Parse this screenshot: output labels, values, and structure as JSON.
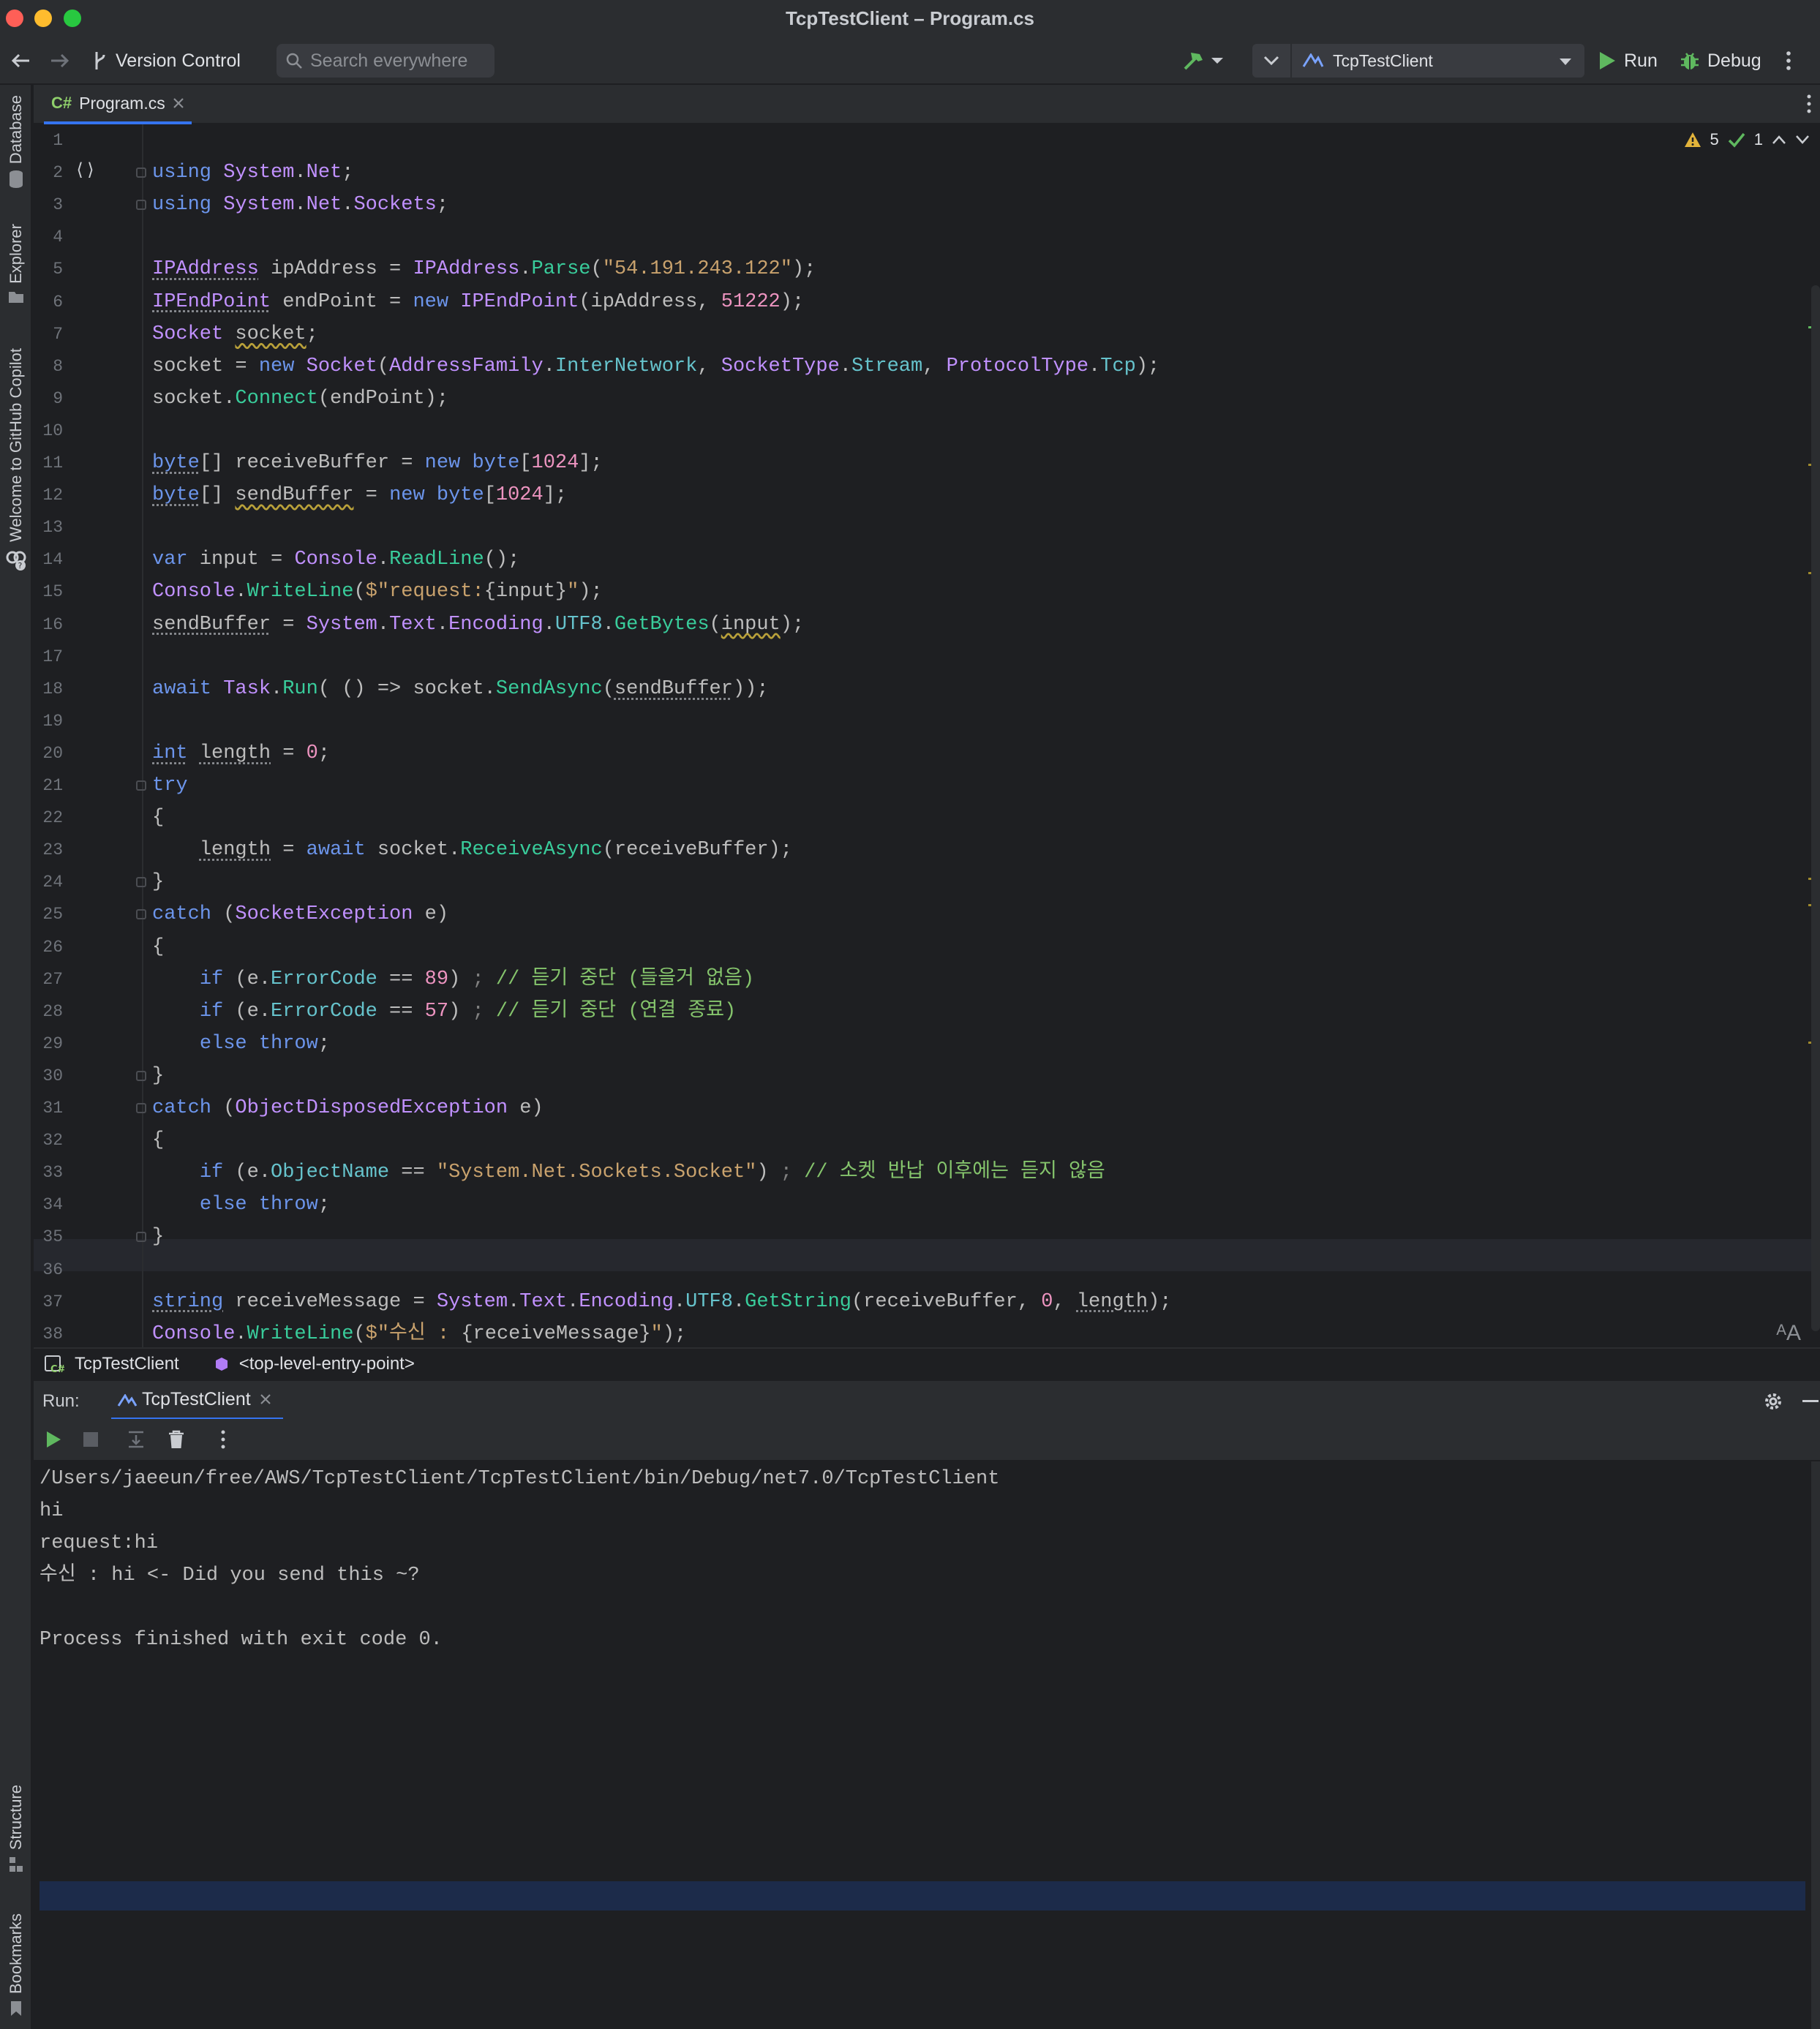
{
  "window": {
    "title": "TcpTestClient – Program.cs"
  },
  "toolbar": {
    "vcs_label": "Version Control",
    "search_placeholder": "Search everywhere",
    "config_name": "TcpTestClient",
    "run_label": "Run",
    "debug_label": "Debug"
  },
  "left_tools": {
    "database": "Database",
    "explorer": "Explorer",
    "copilot": "Welcome to GitHub Copilot",
    "structure": "Structure",
    "bookmarks": "Bookmarks"
  },
  "editor": {
    "tab_lang": "C#",
    "tab_name": "Program.cs",
    "warnings": "5",
    "ok": "1",
    "lines": [
      [],
      [
        [
          "k",
          "using "
        ],
        [
          "t",
          "System"
        ],
        [
          "p",
          "."
        ],
        [
          "t",
          "Net"
        ],
        [
          "p",
          ";"
        ]
      ],
      [
        [
          "k",
          "using "
        ],
        [
          "t",
          "System"
        ],
        [
          "p",
          "."
        ],
        [
          "t",
          "Net"
        ],
        [
          "p",
          "."
        ],
        [
          "t",
          "Sockets"
        ],
        [
          "p",
          ";"
        ]
      ],
      [],
      [
        [
          "tu",
          "IPAddress"
        ],
        [
          "p",
          " ipAddress = "
        ],
        [
          "t",
          "IPAddress"
        ],
        [
          "p",
          "."
        ],
        [
          "m",
          "Parse"
        ],
        [
          "p",
          "("
        ],
        [
          "s",
          "\"54.191.243.122\""
        ],
        [
          "p",
          ");"
        ]
      ],
      [
        [
          "tu",
          "IPEndPoint"
        ],
        [
          "p",
          " endPoint = "
        ],
        [
          "k",
          "new "
        ],
        [
          "t",
          "IPEndPoint"
        ],
        [
          "p",
          "(ipAddress, "
        ],
        [
          "n",
          "51222"
        ],
        [
          "p",
          ");"
        ]
      ],
      [
        [
          "t",
          "Socket"
        ],
        [
          "p",
          " "
        ],
        [
          "pw",
          "socket"
        ],
        [
          "p",
          ";"
        ]
      ],
      [
        [
          "p",
          "socket = "
        ],
        [
          "k",
          "new "
        ],
        [
          "t",
          "Socket"
        ],
        [
          "p",
          "("
        ],
        [
          "t",
          "AddressFamily"
        ],
        [
          "p",
          "."
        ],
        [
          "g",
          "InterNetwork"
        ],
        [
          "p",
          ", "
        ],
        [
          "t",
          "SocketType"
        ],
        [
          "p",
          "."
        ],
        [
          "g",
          "Stream"
        ],
        [
          "p",
          ", "
        ],
        [
          "t",
          "ProtocolType"
        ],
        [
          "p",
          "."
        ],
        [
          "g",
          "Tcp"
        ],
        [
          "p",
          ");"
        ]
      ],
      [
        [
          "p",
          "socket."
        ],
        [
          "m",
          "Connect"
        ],
        [
          "p",
          "(endPoint);"
        ]
      ],
      [],
      [
        [
          "ku",
          "byte"
        ],
        [
          "p",
          "[] receiveBuffer = "
        ],
        [
          "k",
          "new "
        ],
        [
          "k",
          "byte"
        ],
        [
          "p",
          "["
        ],
        [
          "n",
          "1024"
        ],
        [
          "p",
          "];"
        ]
      ],
      [
        [
          "ku",
          "byte"
        ],
        [
          "p",
          "[] "
        ],
        [
          "pw",
          "sendBuffer"
        ],
        [
          "p",
          " = "
        ],
        [
          "k",
          "new "
        ],
        [
          "k",
          "byte"
        ],
        [
          "p",
          "["
        ],
        [
          "n",
          "1024"
        ],
        [
          "p",
          "];"
        ]
      ],
      [],
      [
        [
          "k",
          "var"
        ],
        [
          "p",
          " input = "
        ],
        [
          "t",
          "Console"
        ],
        [
          "p",
          "."
        ],
        [
          "m",
          "ReadLine"
        ],
        [
          "p",
          "();"
        ]
      ],
      [
        [
          "t",
          "Console"
        ],
        [
          "p",
          "."
        ],
        [
          "m",
          "WriteLine"
        ],
        [
          "p",
          "("
        ],
        [
          "s",
          "$\"request:"
        ],
        [
          "p",
          "{input}"
        ],
        [
          "s",
          "\""
        ],
        [
          "p",
          ");"
        ]
      ],
      [
        [
          "pu",
          "sendBuffer"
        ],
        [
          "p",
          " = "
        ],
        [
          "t",
          "System"
        ],
        [
          "p",
          "."
        ],
        [
          "t",
          "Text"
        ],
        [
          "p",
          "."
        ],
        [
          "t",
          "Encoding"
        ],
        [
          "p",
          "."
        ],
        [
          "g",
          "UTF8"
        ],
        [
          "p",
          "."
        ],
        [
          "m",
          "GetBytes"
        ],
        [
          "p",
          "("
        ],
        [
          "pw",
          "input"
        ],
        [
          "p",
          ");"
        ]
      ],
      [],
      [
        [
          "k",
          "await "
        ],
        [
          "t",
          "Task"
        ],
        [
          "p",
          "."
        ],
        [
          "m",
          "Run"
        ],
        [
          "p",
          "( () => socket."
        ],
        [
          "m",
          "SendAsync"
        ],
        [
          "p",
          "("
        ],
        [
          "pu",
          "sendBuffer"
        ],
        [
          "p",
          "));"
        ]
      ],
      [],
      [
        [
          "ku",
          "int"
        ],
        [
          "p",
          " "
        ],
        [
          "pu",
          "length"
        ],
        [
          "p",
          " = "
        ],
        [
          "n",
          "0"
        ],
        [
          "p",
          ";"
        ]
      ],
      [
        [
          "k",
          "try"
        ]
      ],
      [
        [
          "p",
          "{"
        ]
      ],
      [
        [
          "p",
          "    "
        ],
        [
          "pu",
          "length"
        ],
        [
          "p",
          " = "
        ],
        [
          "k",
          "await "
        ],
        [
          "p",
          "socket."
        ],
        [
          "m",
          "ReceiveAsync"
        ],
        [
          "p",
          "(receiveBuffer);"
        ]
      ],
      [
        [
          "p",
          "}"
        ]
      ],
      [
        [
          "k",
          "catch "
        ],
        [
          "p",
          "("
        ],
        [
          "t",
          "SocketException"
        ],
        [
          "p",
          " e)"
        ]
      ],
      [
        [
          "p",
          "{"
        ]
      ],
      [
        [
          "p",
          "    "
        ],
        [
          "k",
          "if "
        ],
        [
          "p",
          "(e."
        ],
        [
          "g",
          "ErrorCode"
        ],
        [
          "p",
          " == "
        ],
        [
          "n",
          "89"
        ],
        [
          "p",
          ") "
        ],
        [
          "f",
          ";"
        ],
        [
          "c",
          " // 듣기 중단 (들을거 없음)"
        ]
      ],
      [
        [
          "p",
          "    "
        ],
        [
          "k",
          "if "
        ],
        [
          "p",
          "(e."
        ],
        [
          "g",
          "ErrorCode"
        ],
        [
          "p",
          " == "
        ],
        [
          "n",
          "57"
        ],
        [
          "p",
          ") "
        ],
        [
          "f",
          ";"
        ],
        [
          "c",
          " // 듣기 중단 (연결 종료)"
        ]
      ],
      [
        [
          "p",
          "    "
        ],
        [
          "k",
          "else throw"
        ],
        [
          "p",
          ";"
        ]
      ],
      [
        [
          "p",
          "}"
        ]
      ],
      [
        [
          "k",
          "catch "
        ],
        [
          "p",
          "("
        ],
        [
          "t",
          "ObjectDisposedException"
        ],
        [
          "p",
          " e)"
        ]
      ],
      [
        [
          "p",
          "{"
        ]
      ],
      [
        [
          "p",
          "    "
        ],
        [
          "k",
          "if "
        ],
        [
          "p",
          "(e."
        ],
        [
          "g",
          "ObjectName"
        ],
        [
          "p",
          " == "
        ],
        [
          "s",
          "\"System.Net.Sockets.Socket\""
        ],
        [
          "p",
          ") "
        ],
        [
          "f",
          ";"
        ],
        [
          "c",
          " // 소켓 반납 이후에는 듣지 않음"
        ]
      ],
      [
        [
          "p",
          "    "
        ],
        [
          "k",
          "else throw"
        ],
        [
          "p",
          ";"
        ]
      ],
      [
        [
          "p",
          "}"
        ]
      ],
      [],
      [
        [
          "ku",
          "string"
        ],
        [
          "p",
          " receiveMessage = "
        ],
        [
          "t",
          "System"
        ],
        [
          "p",
          "."
        ],
        [
          "t",
          "Text"
        ],
        [
          "p",
          "."
        ],
        [
          "t",
          "Encoding"
        ],
        [
          "p",
          "."
        ],
        [
          "g",
          "UTF8"
        ],
        [
          "p",
          "."
        ],
        [
          "m",
          "GetString"
        ],
        [
          "p",
          "(receiveBuffer, "
        ],
        [
          "n",
          "0"
        ],
        [
          "p",
          ", "
        ],
        [
          "pu",
          "length"
        ],
        [
          "p",
          ");"
        ]
      ],
      [
        [
          "t",
          "Console"
        ],
        [
          "p",
          "."
        ],
        [
          "m",
          "WriteLine"
        ],
        [
          "p",
          "("
        ],
        [
          "s",
          "$\"수신 : "
        ],
        [
          "p",
          "{receiveMessage}"
        ],
        [
          "s",
          "\""
        ],
        [
          "p",
          ");"
        ]
      ]
    ]
  },
  "breadcrumb": {
    "project": "TcpTestClient",
    "member": "<top-level-entry-point>"
  },
  "run": {
    "label": "Run:",
    "tab_name": "TcpTestClient",
    "output": [
      "/Users/jaeeun/free/AWS/TcpTestClient/TcpTestClient/bin/Debug/net7.0/TcpTestClient",
      "hi",
      "request:hi",
      "수신 : hi <- Did you send this ~?",
      "",
      "Process finished with exit code 0."
    ]
  },
  "colors": {
    "accent": "#3574f0",
    "run_green": "#5fb85f",
    "warning": "#e2b33b"
  }
}
